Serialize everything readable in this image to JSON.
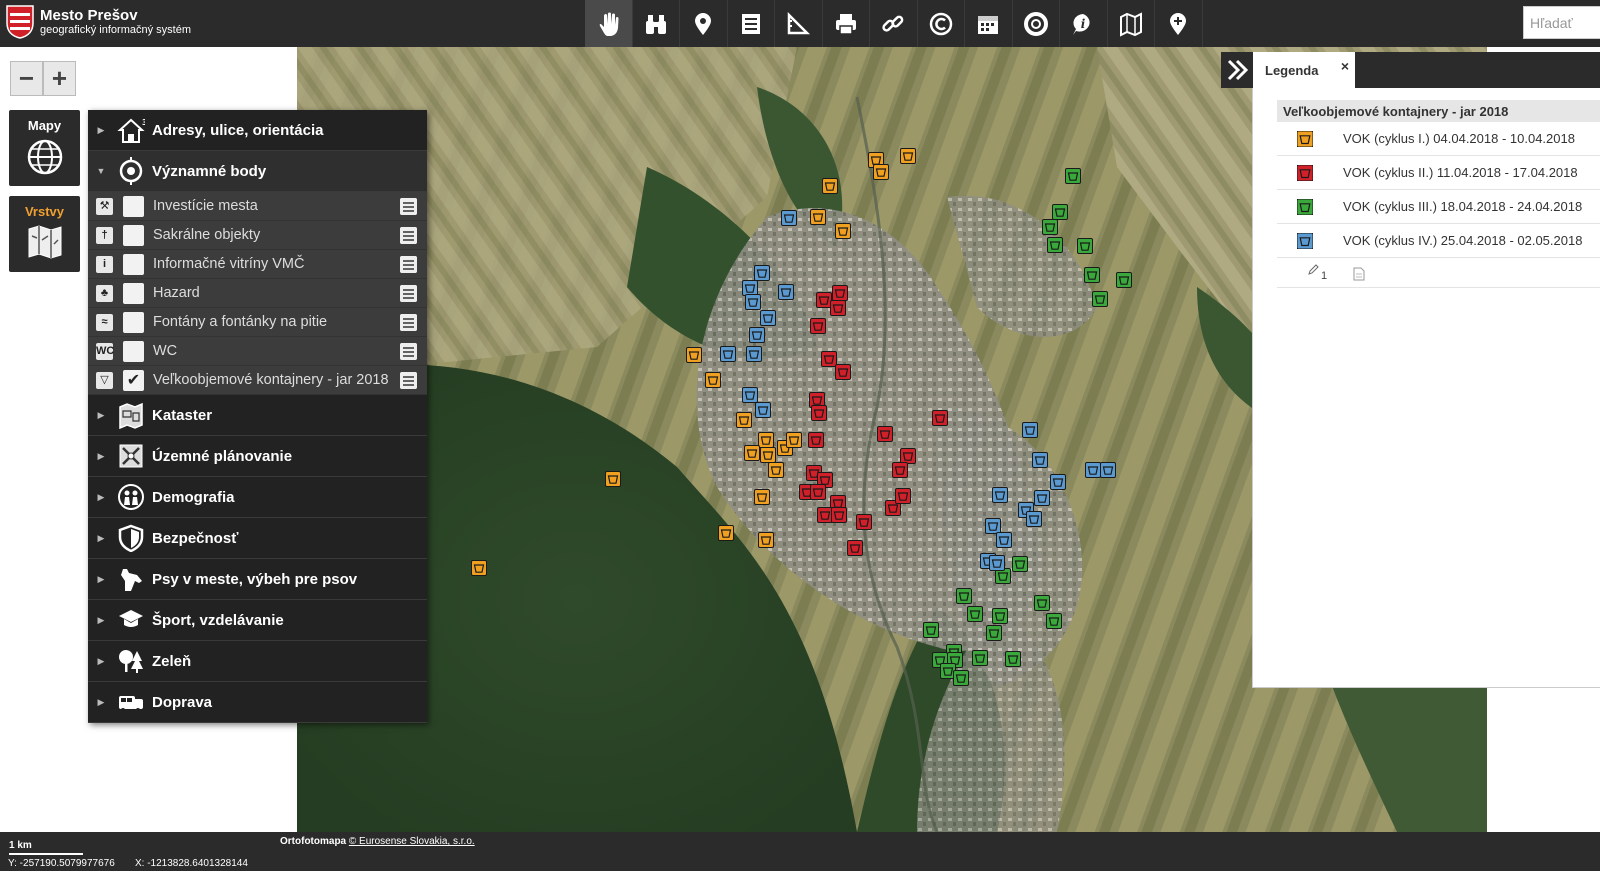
{
  "brand": {
    "line1": "Mesto Prešov",
    "line2": "geografický informačný systém"
  },
  "toolbar": {
    "tools": [
      "hand-icon",
      "binoculars-icon",
      "map-pin-icon",
      "list-icon",
      "ruler-icon",
      "printer-icon",
      "link-icon",
      "copyright-icon",
      "calendar-icon",
      "lifebuoy-icon",
      "info-icon",
      "map-icon",
      "location-add-icon"
    ],
    "active_tool": "hand-icon"
  },
  "search": {
    "placeholder": "Hľadať"
  },
  "side": {
    "maps_label": "Mapy",
    "layers_label": "Vrstvy",
    "layers_color": "#f0a030"
  },
  "zoom": {
    "out": "−",
    "in": "+"
  },
  "layers": {
    "groups": [
      {
        "label": "Adresy, ulice, orientácia",
        "icon": "house-icon"
      },
      {
        "label": "Významné body",
        "icon": "target-icon",
        "open": true
      },
      {
        "label": "Kataster",
        "icon": "cadastre-icon"
      },
      {
        "label": "Územné plánovanie",
        "icon": "planning-icon"
      },
      {
        "label": "Demografia",
        "icon": "people-icon"
      },
      {
        "label": "Bezpečnosť",
        "icon": "shield-icon"
      },
      {
        "label": "Psy v meste, výbeh pre psov",
        "icon": "dog-icon"
      },
      {
        "label": "Šport, vzdelávanie",
        "icon": "graduation-cap-icon"
      },
      {
        "label": "Zeleň",
        "icon": "trees-icon"
      },
      {
        "label": "Doprava",
        "icon": "bus-icon"
      }
    ],
    "items": [
      {
        "label": "Investície mesta",
        "glyph": "⚒",
        "checked": false
      },
      {
        "label": "Sakrálne objekty",
        "glyph": "†",
        "checked": false
      },
      {
        "label": "Informačné vitríny VMČ",
        "glyph": "i",
        "checked": false
      },
      {
        "label": "Hazard",
        "glyph": "♣",
        "checked": false
      },
      {
        "label": "Fontány a fontánky na pitie",
        "glyph": "≈",
        "checked": false
      },
      {
        "label": "WC",
        "glyph": "WC",
        "checked": false
      },
      {
        "label": "Veľkoobjemové kontajnery - jar 2018",
        "glyph": "▽",
        "checked": true
      }
    ]
  },
  "legend": {
    "tab": "Legenda",
    "close": "×",
    "title": "Veľkoobjemové kontajnery - jar 2018",
    "rows": [
      {
        "label": "VOK (cyklus I.) 04.04.2018 - 10.04.2018",
        "color": "#f0a020"
      },
      {
        "label": "VOK (cyklus II.) 11.04.2018 - 17.04.2018",
        "color": "#d0202a"
      },
      {
        "label": "VOK (cyklus III.) 18.04.2018 - 24.04.2018",
        "color": "#3aa83a"
      },
      {
        "label": "VOK (cyklus IV.) 25.04.2018 - 02.05.2018",
        "color": "#5a9ad0"
      }
    ],
    "footer_count": "1"
  },
  "map": {
    "markers": {
      "orange": [
        [
          876,
          160
        ],
        [
          908,
          156
        ],
        [
          881,
          172
        ],
        [
          830,
          186
        ],
        [
          818,
          217
        ],
        [
          843,
          231
        ],
        [
          694,
          355
        ],
        [
          713,
          380
        ],
        [
          744,
          420
        ],
        [
          766,
          440
        ],
        [
          752,
          453
        ],
        [
          768,
          455
        ],
        [
          785,
          448
        ],
        [
          794,
          440
        ],
        [
          776,
          470
        ],
        [
          762,
          497
        ],
        [
          726,
          533
        ],
        [
          766,
          540
        ],
        [
          613,
          479
        ],
        [
          479,
          568
        ]
      ],
      "red": [
        [
          824,
          300
        ],
        [
          840,
          293
        ],
        [
          838,
          308
        ],
        [
          818,
          326
        ],
        [
          829,
          359
        ],
        [
          843,
          372
        ],
        [
          817,
          400
        ],
        [
          819,
          413
        ],
        [
          816,
          440
        ],
        [
          885,
          434
        ],
        [
          940,
          418
        ],
        [
          908,
          456
        ],
        [
          900,
          470
        ],
        [
          814,
          473
        ],
        [
          825,
          480
        ],
        [
          807,
          492
        ],
        [
          818,
          492
        ],
        [
          838,
          503
        ],
        [
          825,
          515
        ],
        [
          839,
          515
        ],
        [
          864,
          522
        ],
        [
          855,
          548
        ],
        [
          893,
          508
        ],
        [
          903,
          496
        ]
      ],
      "green": [
        [
          1073,
          176
        ],
        [
          1060,
          212
        ],
        [
          1050,
          227
        ],
        [
          1055,
          245
        ],
        [
          1085,
          246
        ],
        [
          1092,
          275
        ],
        [
          1124,
          280
        ],
        [
          1100,
          299
        ],
        [
          1020,
          564
        ],
        [
          1003,
          576
        ],
        [
          964,
          596
        ],
        [
          975,
          614
        ],
        [
          1000,
          616
        ],
        [
          994,
          633
        ],
        [
          1042,
          603
        ],
        [
          1054,
          621
        ],
        [
          931,
          630
        ],
        [
          954,
          652
        ],
        [
          940,
          660
        ],
        [
          955,
          660
        ],
        [
          948,
          671
        ],
        [
          961,
          678
        ],
        [
          980,
          658
        ],
        [
          1013,
          659
        ]
      ],
      "blue": [
        [
          789,
          218
        ],
        [
          762,
          273
        ],
        [
          750,
          288
        ],
        [
          753,
          302
        ],
        [
          786,
          292
        ],
        [
          768,
          318
        ],
        [
          757,
          335
        ],
        [
          728,
          354
        ],
        [
          754,
          354
        ],
        [
          750,
          395
        ],
        [
          763,
          410
        ],
        [
          1030,
          430
        ],
        [
          1040,
          460
        ],
        [
          1058,
          482
        ],
        [
          1093,
          470
        ],
        [
          1108,
          470
        ],
        [
          1000,
          495
        ],
        [
          1042,
          498
        ],
        [
          1026,
          510
        ],
        [
          1034,
          519
        ],
        [
          993,
          526
        ],
        [
          1004,
          540
        ],
        [
          988,
          561
        ],
        [
          997,
          563
        ]
      ]
    }
  },
  "status": {
    "scale_label": "1 km",
    "coord_y": "Y: -257190.5079977676",
    "coord_x": "X: -1213828.6401328144",
    "attribution_prefix": "Ortofotomapa",
    "attribution_link": "© Eurosense Slovakia, s.r.o."
  }
}
